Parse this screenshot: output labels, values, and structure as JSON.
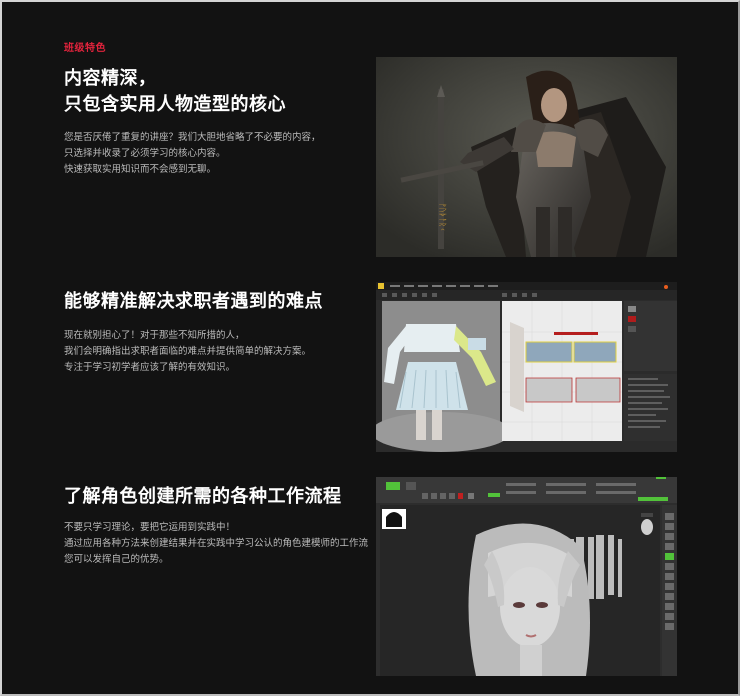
{
  "badge": "班级特色",
  "sections": [
    {
      "title_lines": [
        "内容精深，",
        "只包含实用人物造型的核心"
      ],
      "desc_lines": [
        "您是否厌倦了重复的讲座？我们大胆地省略了不必要的内容，",
        "只选择并收录了必须学习的核心内容。",
        "快速获取实用知识而不会感到无聊。"
      ],
      "image": "fantasy-warrior-character-render",
      "blade_runes": "ᚠᚢᚦᚨᚱᚲ"
    },
    {
      "title_lines": [
        "能够精准解决求职者遇到的难点"
      ],
      "desc_lines": [
        "现在就别担心了！对于那些不知所措的人，",
        "我们会明确指出求职者面临的难点并提供简单的解决方案。",
        "专注于学习初学者应该了解的有效知识。"
      ],
      "image": "marvelous-designer-clothing-screenshot"
    },
    {
      "title_lines": [
        "了解角色创建所需的各种工作流程"
      ],
      "desc_lines": [
        "不要只学习理论，要把它运用到实践中！",
        "通过应用各种方法来创建结果并在实践中学习公认的角色建模师的工作流",
        "您可以发挥自己的优势。"
      ],
      "image": "zbrush-sculpt-screenshot"
    }
  ],
  "colors": {
    "background": "#121212",
    "accent": "#e0233c",
    "title": "#ffffff",
    "body_text": "#bcbcbc"
  }
}
